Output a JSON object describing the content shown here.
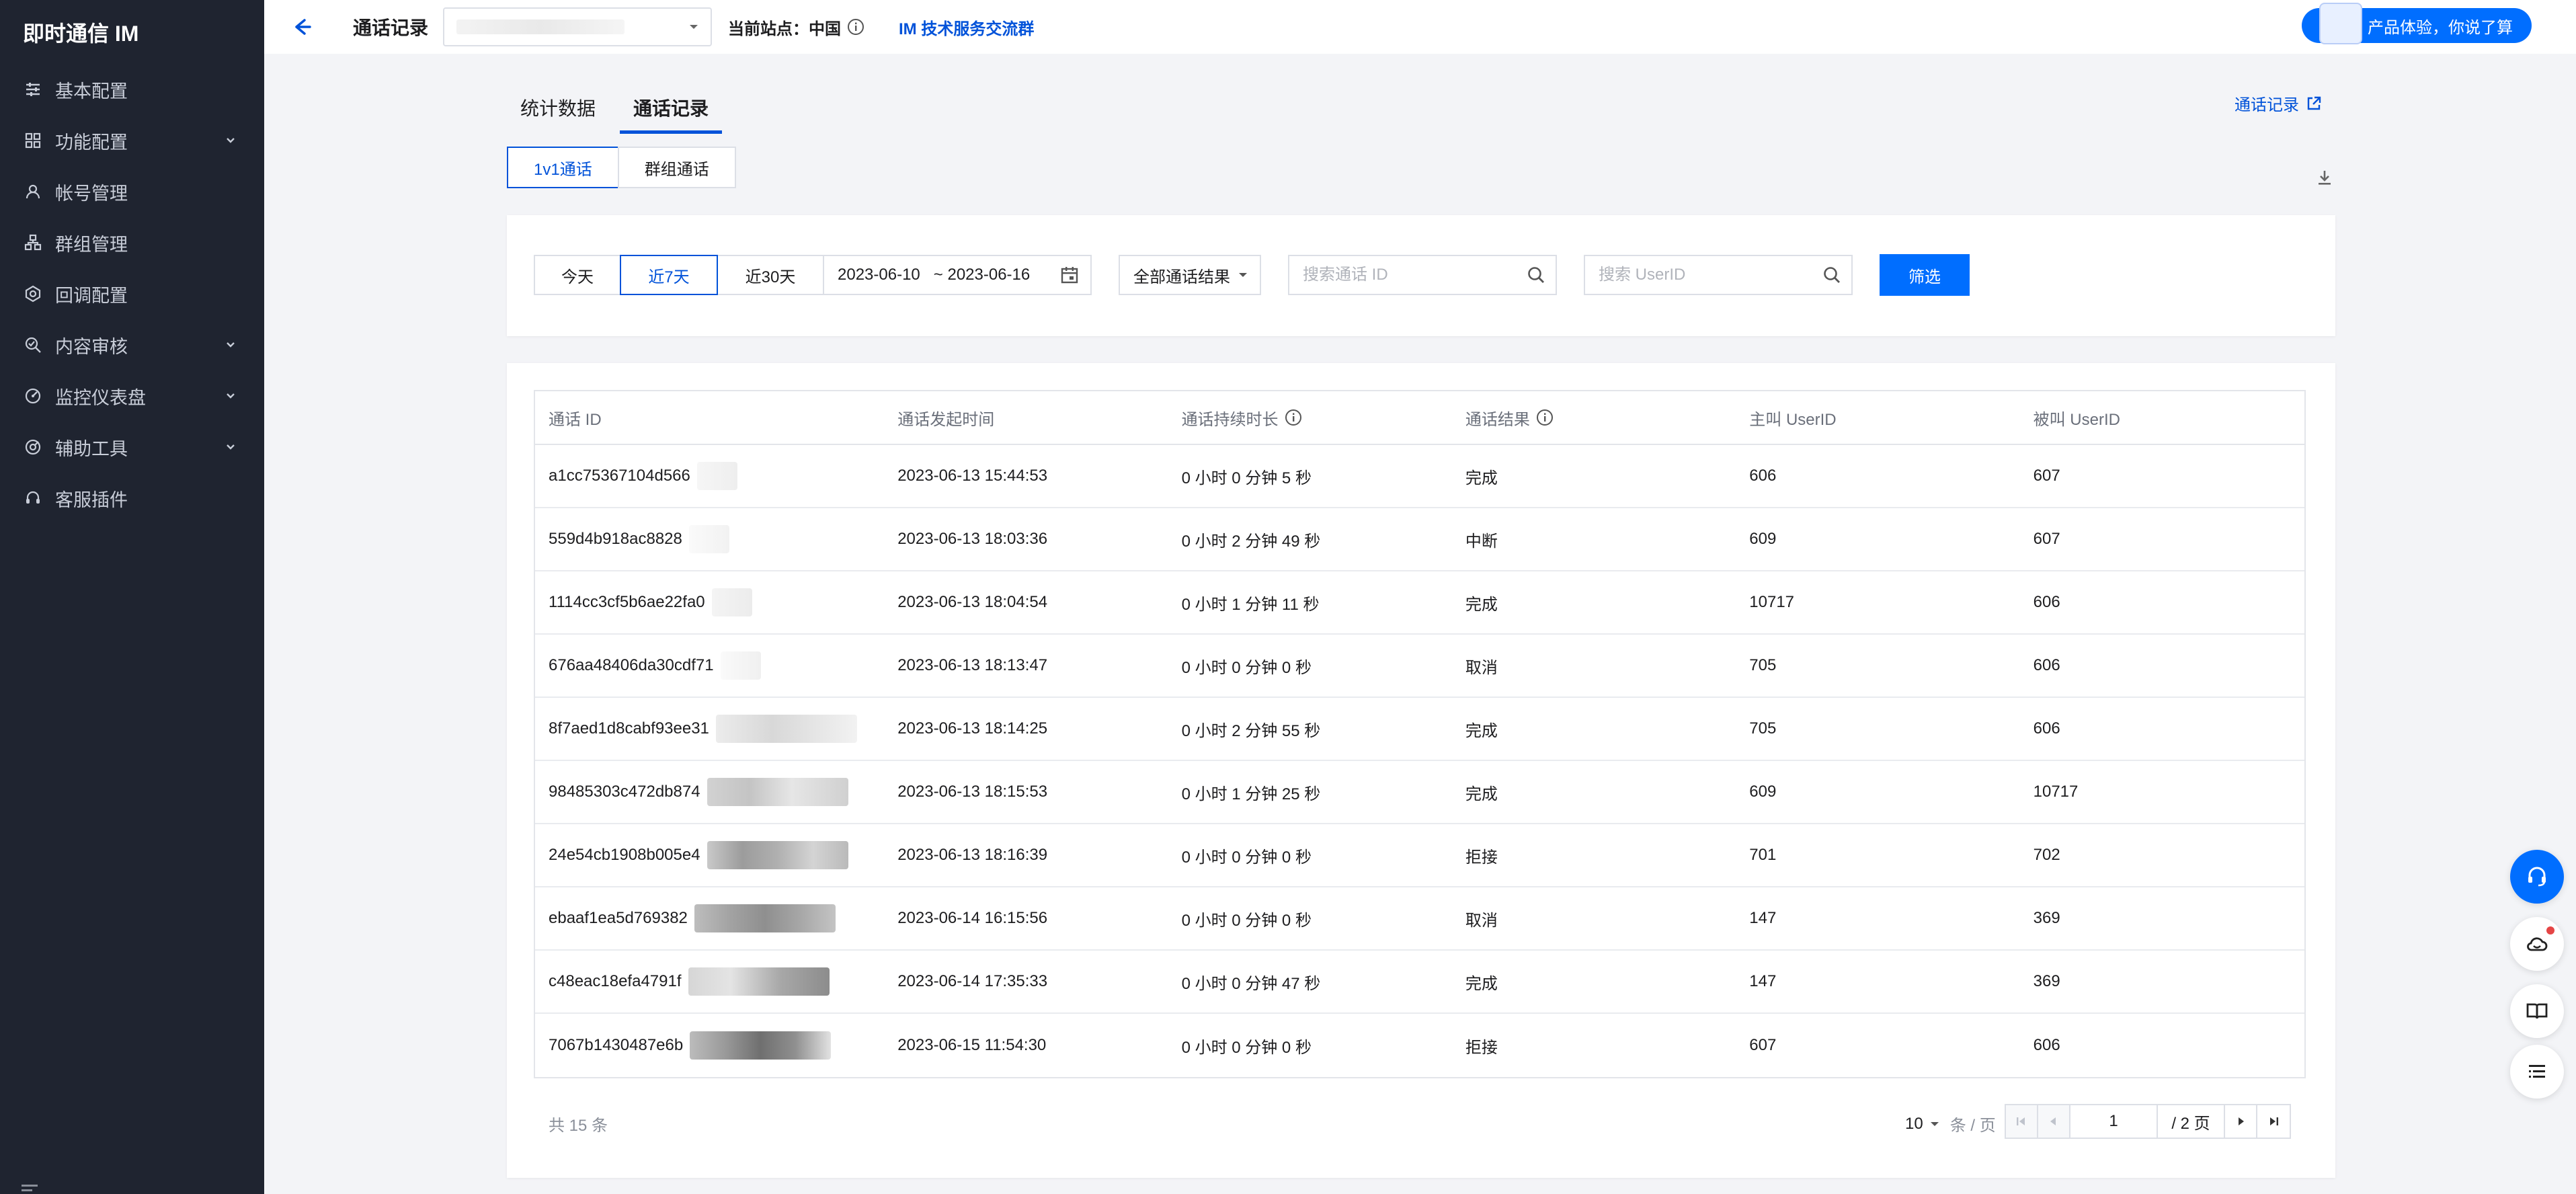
{
  "sidebar": {
    "brand": "即时通信 IM",
    "items": [
      {
        "label": "基本配置",
        "icon": "sliders-icon",
        "has_chevron": false
      },
      {
        "label": "功能配置",
        "icon": "grid-icon",
        "has_chevron": true
      },
      {
        "label": "帐号管理",
        "icon": "user-icon",
        "has_chevron": false
      },
      {
        "label": "群组管理",
        "icon": "group-icon",
        "has_chevron": false
      },
      {
        "label": "回调配置",
        "icon": "callback-icon",
        "has_chevron": false
      },
      {
        "label": "内容审核",
        "icon": "audit-icon",
        "has_chevron": true
      },
      {
        "label": "监控仪表盘",
        "icon": "dashboard-icon",
        "has_chevron": true
      },
      {
        "label": "辅助工具",
        "icon": "tools-icon",
        "has_chevron": true
      },
      {
        "label": "客服插件",
        "icon": "headset-icon",
        "has_chevron": false
      }
    ]
  },
  "topbar": {
    "title": "通话记录",
    "app_select_value": "",
    "site_label": "当前站点：中国",
    "im_link": "IM 技术服务交流群",
    "feedback": "产品体验，你说了算"
  },
  "main": {
    "tabs": [
      {
        "label": "统计数据",
        "active": false
      },
      {
        "label": "通话记录",
        "active": true
      }
    ],
    "link_right": "通话记录",
    "segments": [
      {
        "label": "1v1通话",
        "active": true
      },
      {
        "label": "群组通话",
        "active": false
      }
    ]
  },
  "filter": {
    "quick": [
      {
        "label": "今天",
        "active": false
      },
      {
        "label": "近7天",
        "active": true
      },
      {
        "label": "近30天",
        "active": false
      }
    ],
    "date_start": "2023-06-10",
    "date_end": "2023-06-16",
    "result_select": "全部通话结果",
    "search_call_placeholder": "搜索通话 ID",
    "search_user_placeholder": "搜索 UserID",
    "filter_button": "筛选"
  },
  "table": {
    "headers": [
      "通话 ID",
      "通话发起时间",
      "通话持续时长",
      "通话结果",
      "主叫 UserID",
      "被叫 UserID"
    ],
    "rows": [
      {
        "id": "a1cc75367104d566",
        "time": "2023-06-13 15:44:53",
        "duration": "0 小时 0 分钟 5 秒",
        "result": "完成",
        "caller": "606",
        "callee": "607"
      },
      {
        "id": "559d4b918ac8828",
        "time": "2023-06-13 18:03:36",
        "duration": "0 小时 2 分钟 49 秒",
        "result": "中断",
        "caller": "609",
        "callee": "607"
      },
      {
        "id": "1114cc3cf5b6ae22fa0",
        "time": "2023-06-13 18:04:54",
        "duration": "0 小时 1 分钟 11 秒",
        "result": "完成",
        "caller": "10717",
        "callee": "606"
      },
      {
        "id": "676aa48406da30cdf71",
        "time": "2023-06-13 18:13:47",
        "duration": "0 小时 0 分钟 0 秒",
        "result": "取消",
        "caller": "705",
        "callee": "606"
      },
      {
        "id": "8f7aed1d8cabf93ee31",
        "time": "2023-06-13 18:14:25",
        "duration": "0 小时 2 分钟 55 秒",
        "result": "完成",
        "caller": "705",
        "callee": "606"
      },
      {
        "id": "98485303c472db874",
        "time": "2023-06-13 18:15:53",
        "duration": "0 小时 1 分钟 25 秒",
        "result": "完成",
        "caller": "609",
        "callee": "10717"
      },
      {
        "id": "24e54cb1908b005e4",
        "time": "2023-06-13 18:16:39",
        "duration": "0 小时 0 分钟 0 秒",
        "result": "拒接",
        "caller": "701",
        "callee": "702"
      },
      {
        "id": "ebaaf1ea5d769382",
        "time": "2023-06-14 16:15:56",
        "duration": "0 小时 0 分钟 0 秒",
        "result": "取消",
        "caller": "147",
        "callee": "369"
      },
      {
        "id": "c48eac18efa4791f",
        "time": "2023-06-14 17:35:33",
        "duration": "0 小时 0 分钟 47 秒",
        "result": "完成",
        "caller": "147",
        "callee": "369"
      },
      {
        "id": "7067b1430487e6b",
        "time": "2023-06-15 11:54:30",
        "duration": "0 小时 0 分钟 0 秒",
        "result": "拒接",
        "caller": "607",
        "callee": "606"
      }
    ]
  },
  "footer": {
    "total": "共 15 条",
    "page_size": "10",
    "page_size_unit": "条 / 页",
    "current_page": "1",
    "total_pages": "/ 2 页"
  },
  "colors": {
    "accent": "#006eff",
    "link": "#0052d9",
    "sidebar_bg": "#1f2430"
  }
}
